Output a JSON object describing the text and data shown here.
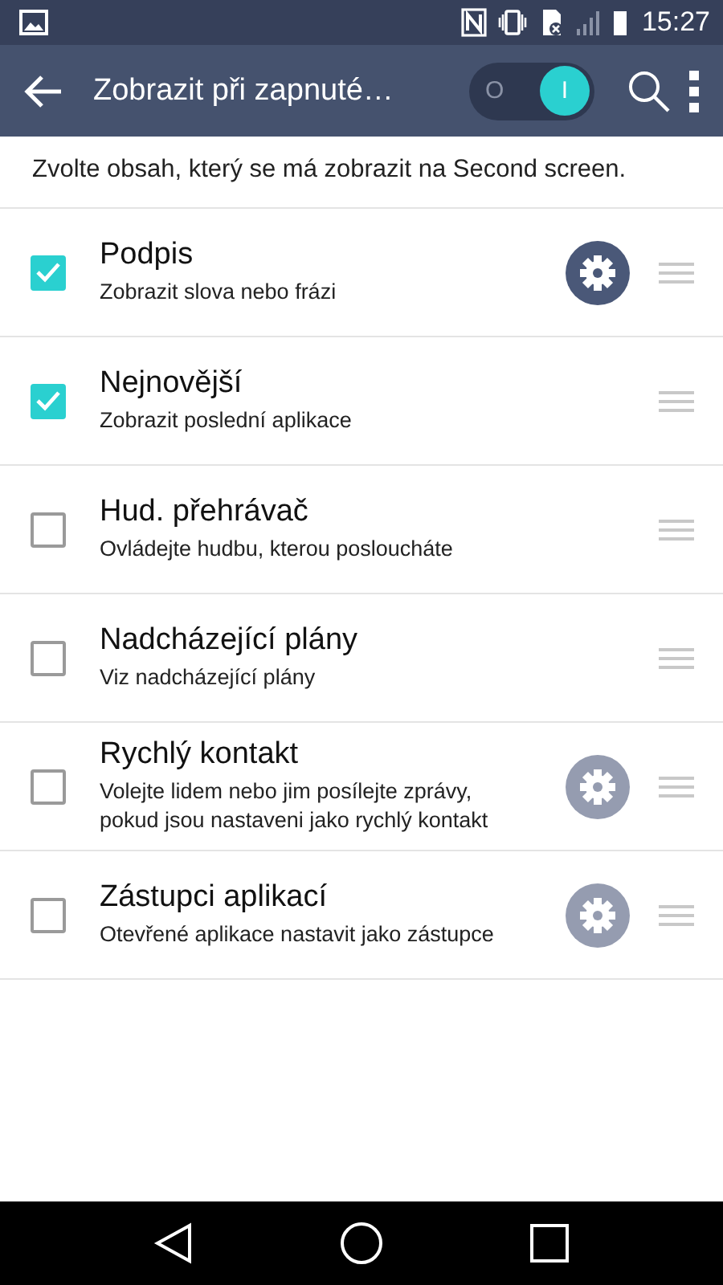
{
  "status_bar": {
    "time": "15:27"
  },
  "app_bar": {
    "title": "Zobrazit při zapnuté…",
    "switch": {
      "on": true,
      "off_label": "O",
      "on_label": "I"
    }
  },
  "intro": "Zvolte obsah, který se má zobrazit na Second screen.",
  "items": [
    {
      "title": "Podpis",
      "subtitle": "Zobrazit slova nebo frázi",
      "checked": true,
      "has_settings": true
    },
    {
      "title": "Nejnovější",
      "subtitle": "Zobrazit poslední aplikace",
      "checked": true,
      "has_settings": false
    },
    {
      "title": "Hud. přehrávač",
      "subtitle": "Ovládejte hudbu, kterou posloucháte",
      "checked": false,
      "has_settings": false
    },
    {
      "title": "Nadcházející plány",
      "subtitle": "Viz nadcházející plány",
      "checked": false,
      "has_settings": false
    },
    {
      "title": "Rychlý kontakt",
      "subtitle": "Volejte lidem nebo jim posílejte zprávy, pokud jsou nastaveni jako rychlý kontakt",
      "checked": false,
      "has_settings": true
    },
    {
      "title": "Zástupci aplikací",
      "subtitle": "Otevřené aplikace nastavit jako zástupce",
      "checked": false,
      "has_settings": true
    }
  ]
}
